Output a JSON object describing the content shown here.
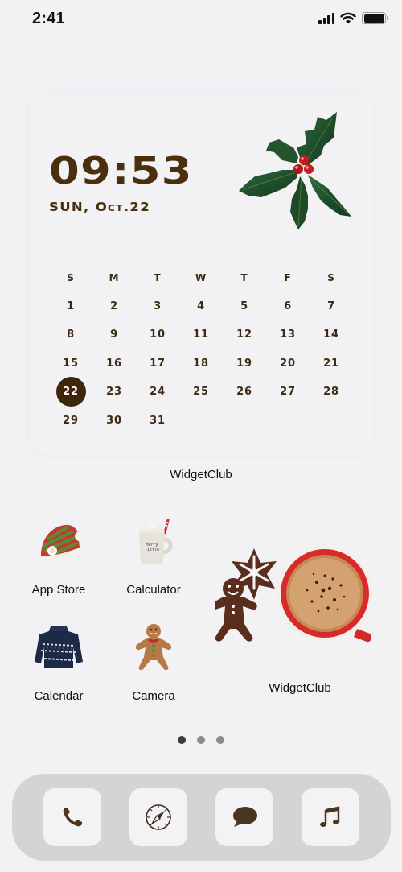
{
  "status_bar": {
    "time": "2:41",
    "signal_bars": 4,
    "wifi": true,
    "battery_percent": 100
  },
  "widget_large": {
    "clock_time": "09:53",
    "date": "SUN, Oct.22",
    "decoration": "holly-sprig",
    "calendar": {
      "weekdays": [
        "S",
        "M",
        "T",
        "W",
        "T",
        "F",
        "S"
      ],
      "weeks": [
        [
          "1",
          "2",
          "3",
          "4",
          "5",
          "6",
          "7"
        ],
        [
          "8",
          "9",
          "10",
          "11",
          "12",
          "13",
          "14"
        ],
        [
          "15",
          "16",
          "17",
          "18",
          "19",
          "20",
          "21"
        ],
        [
          "22",
          "23",
          "24",
          "25",
          "26",
          "27",
          "28"
        ],
        [
          "29",
          "30",
          "31",
          "",
          "",
          "",
          ""
        ]
      ],
      "today": "22"
    },
    "label": "WidgetClub"
  },
  "apps": [
    {
      "label": "App Store",
      "icon": "santa-hat-icon"
    },
    {
      "label": "Calculator",
      "icon": "cocoa-mug-icon"
    },
    {
      "label": "Calendar",
      "icon": "christmas-sweater-icon"
    },
    {
      "label": "Camera",
      "icon": "gingerbread-man-icon"
    }
  ],
  "widget_small": {
    "label": "WidgetClub",
    "image": "cookies-and-coffee"
  },
  "page_dots": {
    "count": 3,
    "active_index": 0
  },
  "dock": [
    {
      "name": "Phone",
      "icon": "phone-icon"
    },
    {
      "name": "Safari",
      "icon": "compass-icon"
    },
    {
      "name": "Messages",
      "icon": "chat-bubble-icon"
    },
    {
      "name": "Music",
      "icon": "music-note-icon"
    }
  ],
  "colors": {
    "background": "#f2f1f4",
    "accent_brown": "#4a2f0e",
    "today_circle": "#3f2509",
    "dock": "#d4d4d5",
    "dock_icon_bg": "#f3f2f4",
    "dock_glyph": "#4b3520"
  }
}
